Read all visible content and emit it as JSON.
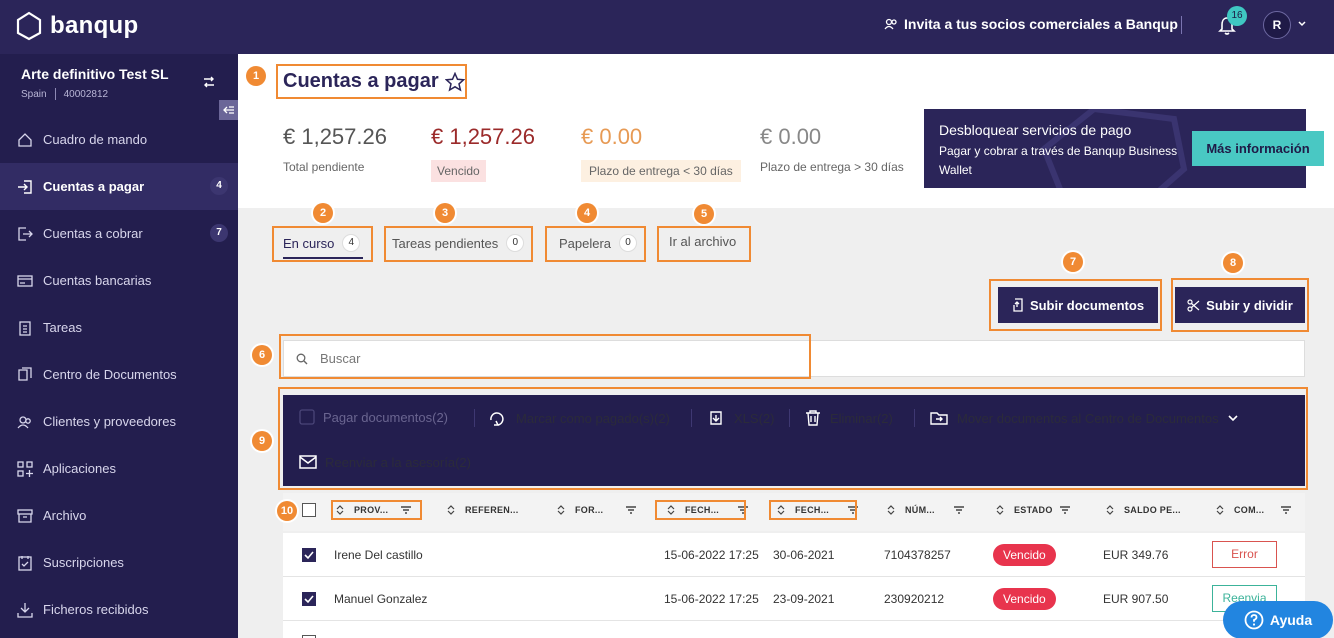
{
  "topbar": {
    "logo_text": "banqup",
    "invite_text": "Invita a tus socios comerciales a Banqup",
    "notifications_count": "16",
    "avatar_initial": "R"
  },
  "sidebar": {
    "company_name": "Arte definitivo Test SL",
    "country": "Spain",
    "company_id": "40002812",
    "items": [
      {
        "label": "Cuadro de mando",
        "icon": "home-icon",
        "badge": ""
      },
      {
        "label": "Cuentas a pagar",
        "icon": "login-icon",
        "badge": "4",
        "active": true
      },
      {
        "label": "Cuentas a cobrar",
        "icon": "logout-icon",
        "badge": "7"
      },
      {
        "label": "Cuentas bancarias",
        "icon": "card-icon",
        "badge": ""
      },
      {
        "label": "Tareas",
        "icon": "clipboard-icon",
        "badge": ""
      },
      {
        "label": "Centro de Documentos",
        "icon": "documents-icon",
        "badge": ""
      },
      {
        "label": "Clientes y proveedores",
        "icon": "people-icon",
        "badge": ""
      },
      {
        "label": "Aplicaciones",
        "icon": "apps-icon",
        "badge": ""
      },
      {
        "label": "Archivo",
        "icon": "archive-icon",
        "badge": ""
      },
      {
        "label": "Suscripciones",
        "icon": "subscriptions-icon",
        "badge": ""
      },
      {
        "label": "Ficheros recibidos",
        "icon": "download-icon",
        "badge": ""
      }
    ]
  },
  "page": {
    "title": "Cuentas a pagar"
  },
  "stats": [
    {
      "amount": "€ 1,257.26",
      "label": "Total pendiente"
    },
    {
      "amount": "€ 1,257.26",
      "label": "Vencido"
    },
    {
      "amount": "€ 0.00",
      "label": "Plazo de entrega < 30 días"
    },
    {
      "amount": "€ 0.00",
      "label": "Plazo de entrega > 30 días"
    }
  ],
  "promo": {
    "title": "Desbloquear servicios de pago",
    "text": "Pagar y cobrar a través de Banqup Business Wallet",
    "button": "Más información"
  },
  "tabs": [
    {
      "label": "En curso",
      "count": "4"
    },
    {
      "label": "Tareas pendientes",
      "count": "0"
    },
    {
      "label": "Papelera",
      "count": "0"
    },
    {
      "label": "Ir al archivo",
      "count": ""
    }
  ],
  "buttons": {
    "upload": "Subir documentos",
    "upload_split": "Subir y dividir"
  },
  "search": {
    "placeholder": "Buscar"
  },
  "actions": {
    "pay": "Pagar documentos(2)",
    "mark_paid": "Marcar como pagado(s)(2)",
    "xls": "XLS(2)",
    "delete": "Eliminar(2)",
    "move": "Mover documentos al Centro de Documentos",
    "resend": "Reenviar a la asesoría(2)"
  },
  "table": {
    "columns": [
      "PROV...",
      "REFEREN...",
      "FOR...",
      "FECH...",
      "FECH...",
      "NÚM...",
      "ESTADO",
      "SALDO PE...",
      "COM..."
    ],
    "rows": [
      {
        "provider": "Irene Del castillo",
        "date1": "15-06-2022 17:25",
        "date2": "30-06-2021",
        "number": "7104378257",
        "status": "Vencido",
        "balance": "EUR 349.76",
        "action": "Error"
      },
      {
        "provider": "Manuel Gonzalez",
        "date1": "15-06-2022 17:25",
        "date2": "23-09-2021",
        "number": "230920212",
        "status": "Vencido",
        "balance": "EUR 907.50",
        "action": "Reenvia"
      }
    ]
  },
  "help": {
    "label": "Ayuda"
  },
  "annotations": [
    "1",
    "2",
    "3",
    "4",
    "5",
    "6",
    "7",
    "8",
    "9",
    "10"
  ],
  "colors": {
    "brand_dark": "#2b2559",
    "sidebar": "#231e4e",
    "accent_teal": "#49c8c3",
    "annotation": "#f08a33",
    "status_red": "#e8344d",
    "help_blue": "#2285e0"
  }
}
